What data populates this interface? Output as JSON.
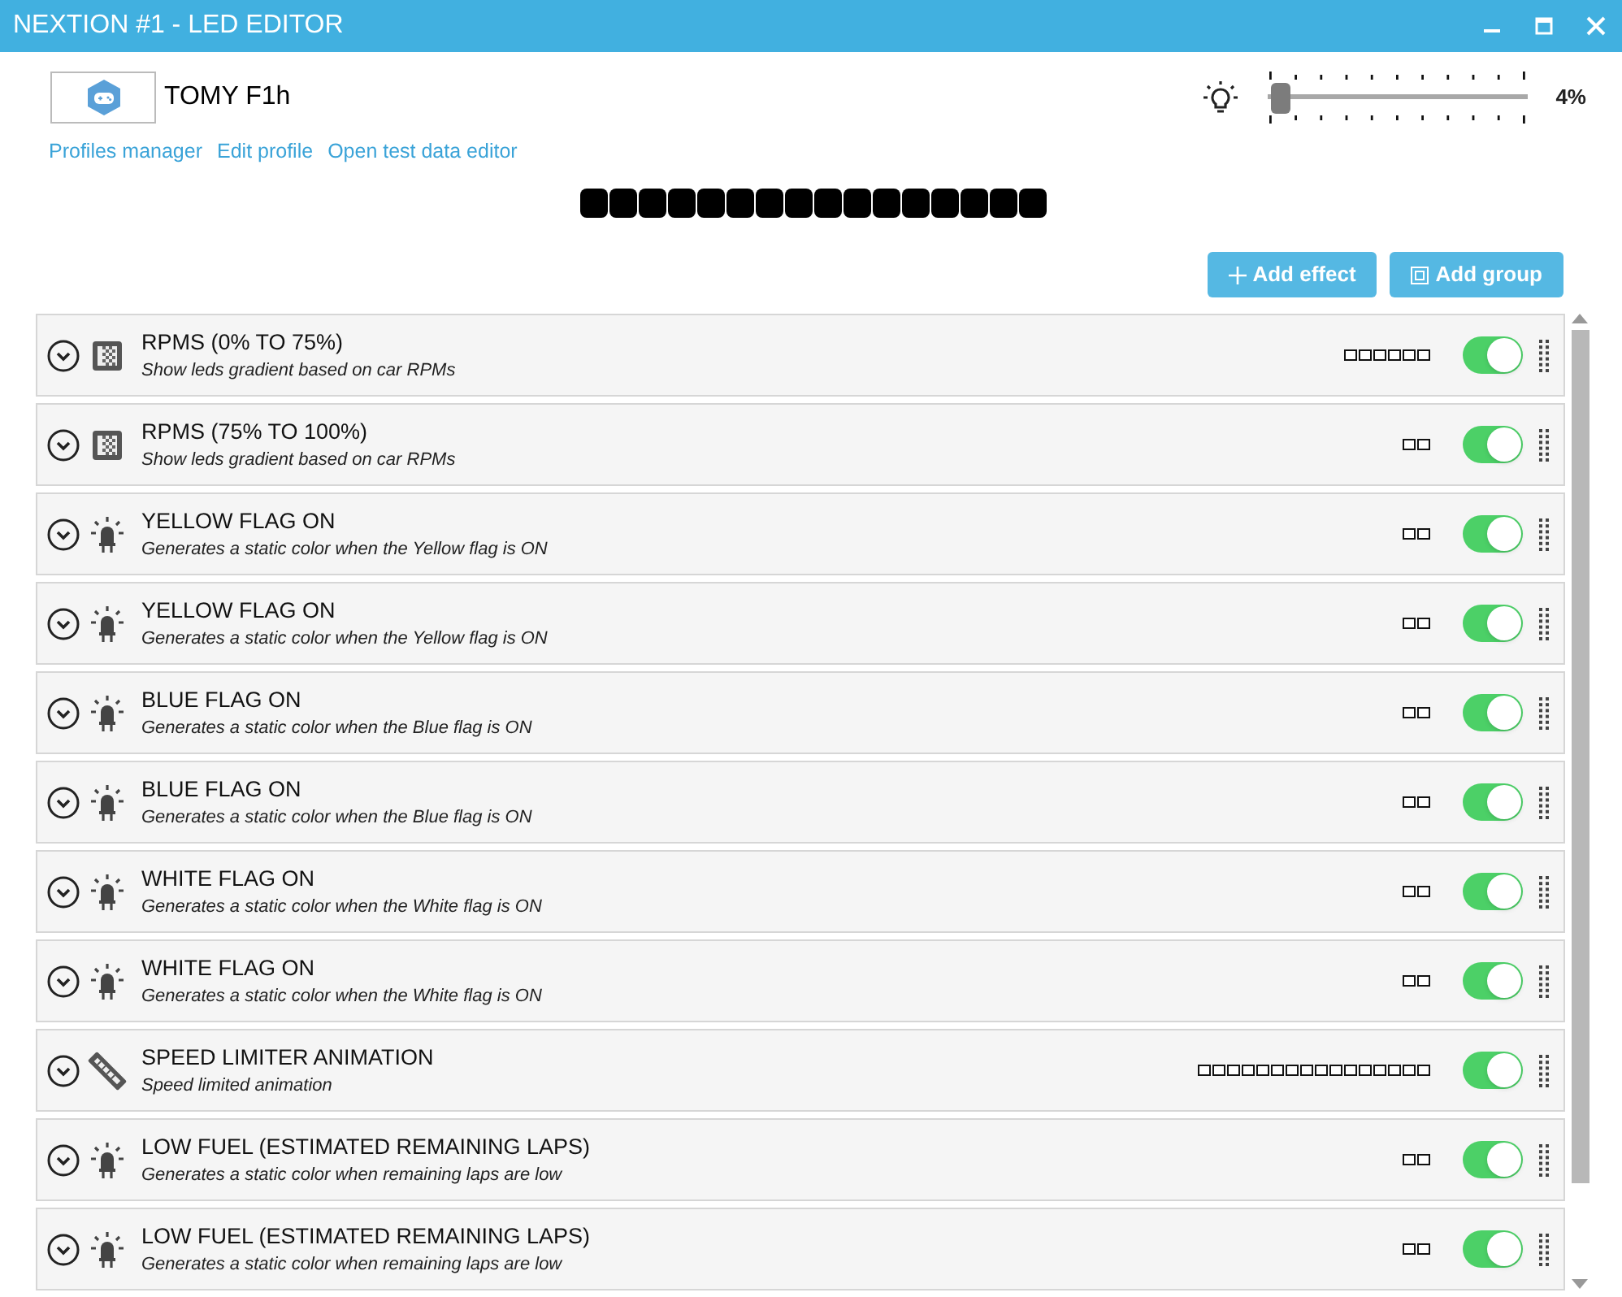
{
  "window": {
    "title": "NEXTION #1 - LED EDITOR"
  },
  "profile": {
    "name": "TOMY F1h"
  },
  "links": [
    "Profiles manager",
    "Edit profile",
    "Open test data editor"
  ],
  "brightness": {
    "level": 0.04,
    "reading": "4%"
  },
  "preview_leds": [
    {
      "color": "#000000"
    },
    {
      "color": "#000000"
    },
    {
      "color": "#000000"
    },
    {
      "color": "#000000"
    },
    {
      "color": "#000000"
    },
    {
      "color": "#000000"
    },
    {
      "color": "#000000"
    },
    {
      "color": "#000000"
    },
    {
      "color": "#000000"
    },
    {
      "color": "#000000"
    },
    {
      "color": "#000000"
    },
    {
      "color": "#000000"
    },
    {
      "color": "#000000"
    },
    {
      "color": "#000000"
    },
    {
      "color": "#000000"
    },
    {
      "color": "#000000"
    }
  ],
  "buttons": [
    {
      "kind": "add",
      "label": "Add effect"
    },
    {
      "kind": "group",
      "label": "Add group"
    }
  ],
  "effects": [
    {
      "kind": "gradient",
      "title": "RPMS (0% TO 75%)",
      "description": "Show leds gradient based on car RPMs",
      "leds": [
        {
          "color": "#ffffff"
        },
        {
          "color": "#ffffff"
        },
        {
          "color": "#ffffff"
        },
        {
          "color": "#ffffff"
        },
        {
          "color": "#ffffff"
        },
        {
          "color": "#ffffff"
        }
      ],
      "on": true
    },
    {
      "kind": "gradient",
      "title": "RPMS (75% TO 100%)",
      "description": "Show leds gradient based on car RPMs",
      "leds": [
        {
          "color": "#ffffff"
        },
        {
          "color": "#ffffff"
        }
      ],
      "on": true
    },
    {
      "kind": "flag",
      "title": "YELLOW FLAG ON",
      "description": "Generates a static color when the Yellow flag is ON",
      "leds": [
        {
          "color": "#ffffff"
        },
        {
          "color": "#ffffff"
        }
      ],
      "on": true
    },
    {
      "kind": "flag",
      "title": "YELLOW FLAG ON",
      "description": "Generates a static color when the Yellow flag is ON",
      "leds": [
        {
          "color": "#ffffff"
        },
        {
          "color": "#ffffff"
        }
      ],
      "on": true
    },
    {
      "kind": "flag",
      "title": "BLUE FLAG ON",
      "description": "Generates a static color when the Blue flag is ON",
      "leds": [
        {
          "color": "#ffffff"
        },
        {
          "color": "#ffffff"
        }
      ],
      "on": true
    },
    {
      "kind": "flag",
      "title": "BLUE FLAG ON",
      "description": "Generates a static color when the Blue flag is ON",
      "leds": [
        {
          "color": "#ffffff"
        },
        {
          "color": "#ffffff"
        }
      ],
      "on": true
    },
    {
      "kind": "flag",
      "title": "WHITE FLAG ON",
      "description": "Generates a static color when the White flag is ON",
      "leds": [
        {
          "color": "#ffffff"
        },
        {
          "color": "#ffffff"
        }
      ],
      "on": true
    },
    {
      "kind": "flag",
      "title": "WHITE FLAG ON",
      "description": "Generates a static color when the White flag is ON",
      "leds": [
        {
          "color": "#ffffff"
        },
        {
          "color": "#ffffff"
        }
      ],
      "on": true
    },
    {
      "kind": "strip",
      "title": "SPEED LIMITER ANIMATION",
      "description": "Speed limited animation",
      "leds": [
        {
          "color": "#ffffff"
        },
        {
          "color": "#ffffff"
        },
        {
          "color": "#ffffff"
        },
        {
          "color": "#ffffff"
        },
        {
          "color": "#ffffff"
        },
        {
          "color": "#ffffff"
        },
        {
          "color": "#ffffff"
        },
        {
          "color": "#ffffff"
        },
        {
          "color": "#ffffff"
        },
        {
          "color": "#ffffff"
        },
        {
          "color": "#ffffff"
        },
        {
          "color": "#ffffff"
        },
        {
          "color": "#ffffff"
        },
        {
          "color": "#ffffff"
        },
        {
          "color": "#ffffff"
        },
        {
          "color": "#ffffff"
        }
      ],
      "on": true
    },
    {
      "kind": "flag",
      "title": "LOW FUEL (ESTIMATED REMAINING LAPS)",
      "description": "Generates a static color when remaining laps are low",
      "leds": [
        {
          "color": "#ffffff"
        },
        {
          "color": "#ffffff"
        }
      ],
      "on": true
    },
    {
      "kind": "flag",
      "title": "LOW FUEL (ESTIMATED REMAINING LAPS)",
      "description": "Generates a static color when remaining laps are low",
      "leds": [
        {
          "color": "#ffffff"
        },
        {
          "color": "#ffffff"
        }
      ],
      "on": true
    }
  ]
}
